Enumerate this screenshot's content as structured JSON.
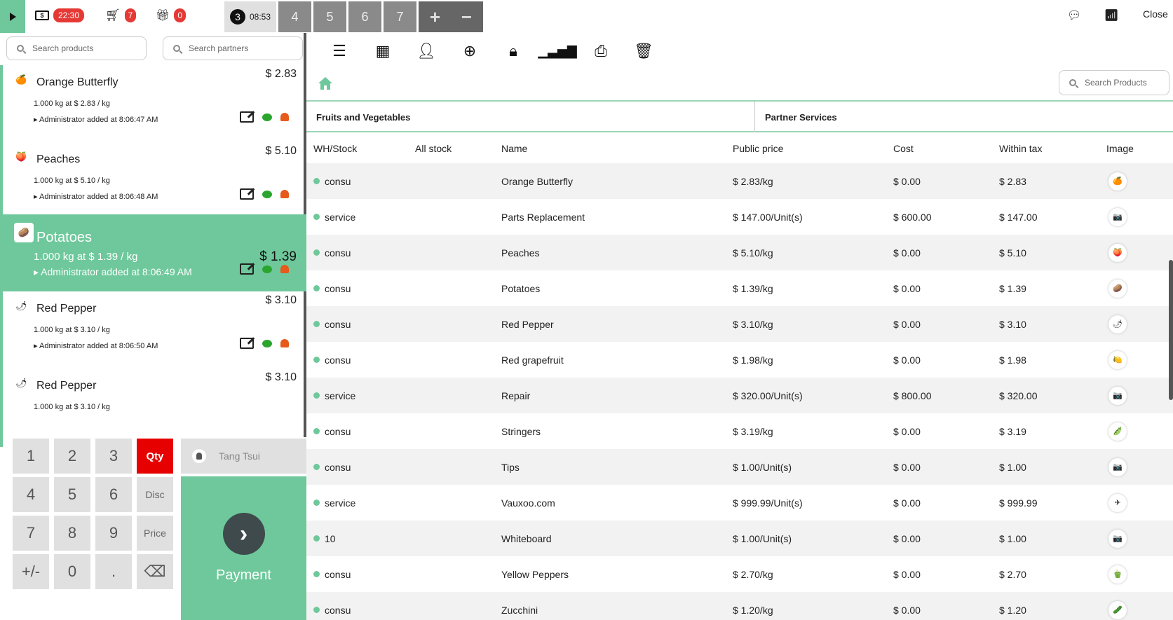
{
  "topbar": {
    "timer_value": "22:30",
    "cart_count": "7",
    "gift_count": "0",
    "active_order_number": "3",
    "active_order_time": "08:53",
    "orders": [
      "4",
      "5",
      "6",
      "7"
    ],
    "add_symbol": "+",
    "remove_symbol": "−",
    "close_label": "Close"
  },
  "left": {
    "search_products_placeholder": "Search products",
    "search_partners_placeholder": "Search partners",
    "lines": [
      {
        "name": "Orange Butterfly",
        "price": "$ 2.83",
        "qty": "1.000 kg at $ 2.83 / kg",
        "added": "Administrator added at 8:06:47 AM",
        "thumb": "🍊"
      },
      {
        "name": "Peaches",
        "price": "$ 5.10",
        "qty": "1.000 kg at $ 5.10 / kg",
        "added": "Administrator added at 8:06:48 AM",
        "thumb": "🍑"
      },
      {
        "name": "Potatoes",
        "price": "$ 1.39",
        "qty": "1.000 kg at $ 1.39 / kg",
        "added": "Administrator added at 8:06:49 AM",
        "thumb": "🥔"
      },
      {
        "name": "Red Pepper",
        "price": "$ 3.10",
        "qty": "1.000 kg at $ 3.10 / kg",
        "added": "Administrator added at 8:06:50 AM",
        "thumb": "🌶"
      },
      {
        "name": "Red Pepper",
        "price": "$ 3.10",
        "qty": "1.000 kg at $ 3.10 / kg",
        "added": "",
        "thumb": "🌶"
      }
    ],
    "numpad": {
      "k1": "1",
      "k2": "2",
      "k3": "3",
      "k4": "4",
      "k5": "5",
      "k6": "6",
      "k7": "7",
      "k8": "8",
      "k9": "9",
      "kpm": "+/-",
      "k0": "0",
      "kdot": ".",
      "kbs": "⌫",
      "qty": "Qty",
      "disc": "Disc",
      "price": "Price"
    },
    "customer": "Tang Tsui",
    "payment_label": "Payment",
    "payment_icon": "›"
  },
  "right": {
    "search_products_placeholder": "Search Products",
    "categories": [
      "Fruits and Vegetables",
      "Partner Services"
    ],
    "headers": {
      "wh": "WH/Stock",
      "all": "All stock",
      "name": "Name",
      "public": "Public price",
      "cost": "Cost",
      "tax": "Within tax",
      "image": "Image"
    },
    "rows": [
      {
        "wh": "consu",
        "name": "Orange Butterfly",
        "public": "$ 2.83/kg",
        "cost": "$ 0.00",
        "tax": "$ 2.83",
        "img": "🍊"
      },
      {
        "wh": "service",
        "name": "Parts Replacement",
        "public": "$ 147.00/Unit(s)",
        "cost": "$ 600.00",
        "tax": "$ 147.00",
        "img": "📷"
      },
      {
        "wh": "consu",
        "name": "Peaches",
        "public": "$ 5.10/kg",
        "cost": "$ 0.00",
        "tax": "$ 5.10",
        "img": "🍑"
      },
      {
        "wh": "consu",
        "name": "Potatoes",
        "public": "$ 1.39/kg",
        "cost": "$ 0.00",
        "tax": "$ 1.39",
        "img": "🥔"
      },
      {
        "wh": "consu",
        "name": "Red Pepper",
        "public": "$ 3.10/kg",
        "cost": "$ 0.00",
        "tax": "$ 3.10",
        "img": "🌶"
      },
      {
        "wh": "consu",
        "name": "Red grapefruit",
        "public": "$ 1.98/kg",
        "cost": "$ 0.00",
        "tax": "$ 1.98",
        "img": "🍋"
      },
      {
        "wh": "service",
        "name": "Repair",
        "public": "$ 320.00/Unit(s)",
        "cost": "$ 800.00",
        "tax": "$ 320.00",
        "img": "📷"
      },
      {
        "wh": "consu",
        "name": "Stringers",
        "public": "$ 3.19/kg",
        "cost": "$ 0.00",
        "tax": "$ 3.19",
        "img": "🫛"
      },
      {
        "wh": "consu",
        "name": "Tips",
        "public": "$ 1.00/Unit(s)",
        "cost": "$ 0.00",
        "tax": "$ 1.00",
        "img": "📷"
      },
      {
        "wh": "service",
        "name": "Vauxoo.com",
        "public": "$ 999.99/Unit(s)",
        "cost": "$ 0.00",
        "tax": "$ 999.99",
        "img": "✈"
      },
      {
        "wh": "10",
        "name": "Whiteboard",
        "public": "$ 1.00/Unit(s)",
        "cost": "$ 0.00",
        "tax": "$ 1.00",
        "img": "📷"
      },
      {
        "wh": "consu",
        "name": "Yellow Peppers",
        "public": "$ 2.70/kg",
        "cost": "$ 0.00",
        "tax": "$ 2.70",
        "img": "🫑"
      },
      {
        "wh": "consu",
        "name": "Zucchini",
        "public": "$ 1.20/kg",
        "cost": "$ 0.00",
        "tax": "$ 1.20",
        "img": "🥒"
      }
    ]
  },
  "colors": {
    "accent": "#6ec89b",
    "danger": "#e60000",
    "badge": "#e53935"
  }
}
